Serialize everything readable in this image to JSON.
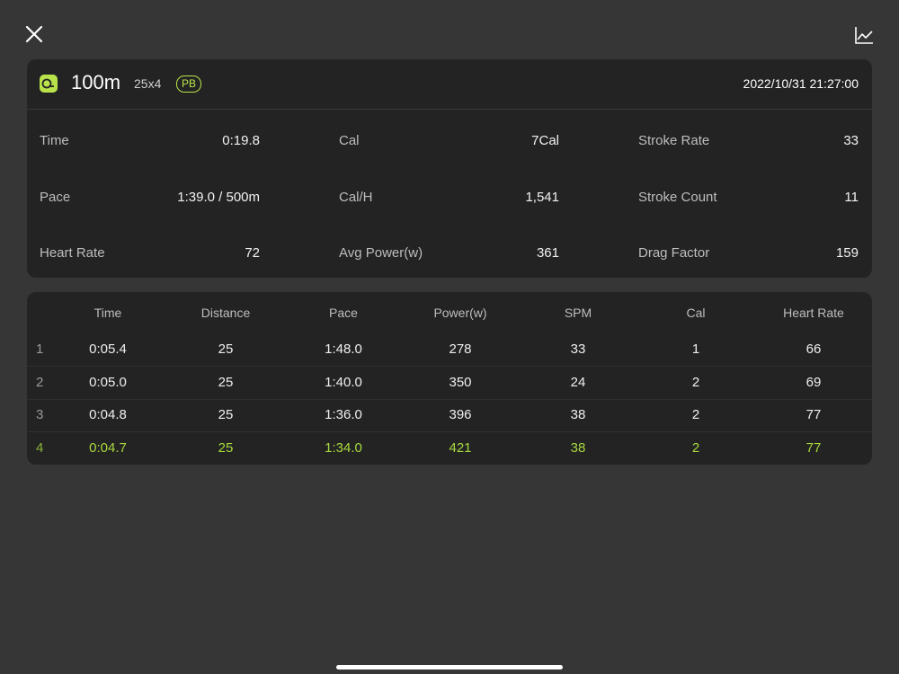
{
  "colors": {
    "accent": "#b9e34a",
    "background": "#363636",
    "card": "#232323"
  },
  "header": {
    "close_icon": "close-icon",
    "chart_icon": "line-chart-icon"
  },
  "summary": {
    "title": "100m",
    "subtitle": "25x4",
    "pb_label": "PB",
    "date": "2022/10/31 21:27:00",
    "stats": [
      {
        "label": "Time",
        "value": "0:19.8"
      },
      {
        "label": "Cal",
        "value": "7Cal"
      },
      {
        "label": "Stroke Rate",
        "value": "33"
      },
      {
        "label": "Pace",
        "value": "1:39.0 / 500m"
      },
      {
        "label": "Cal/H",
        "value": "1,541"
      },
      {
        "label": "Stroke Count",
        "value": "11"
      },
      {
        "label": "Heart Rate",
        "value": "72"
      },
      {
        "label": "Avg Power(w)",
        "value": "361"
      },
      {
        "label": "Drag Factor",
        "value": "159"
      }
    ]
  },
  "splits": {
    "columns": [
      "Time",
      "Distance",
      "Pace",
      "Power(w)",
      "SPM",
      "Cal",
      "Heart Rate"
    ],
    "rows": [
      {
        "index": "1",
        "cells": [
          "0:05.4",
          "25",
          "1:48.0",
          "278",
          "33",
          "1",
          "66"
        ]
      },
      {
        "index": "2",
        "cells": [
          "0:05.0",
          "25",
          "1:40.0",
          "350",
          "24",
          "2",
          "69"
        ]
      },
      {
        "index": "3",
        "cells": [
          "0:04.8",
          "25",
          "1:36.0",
          "396",
          "38",
          "2",
          "77"
        ]
      },
      {
        "index": "4",
        "cells": [
          "0:04.7",
          "25",
          "1:34.0",
          "421",
          "38",
          "2",
          "77"
        ]
      }
    ],
    "best_row": 4
  }
}
